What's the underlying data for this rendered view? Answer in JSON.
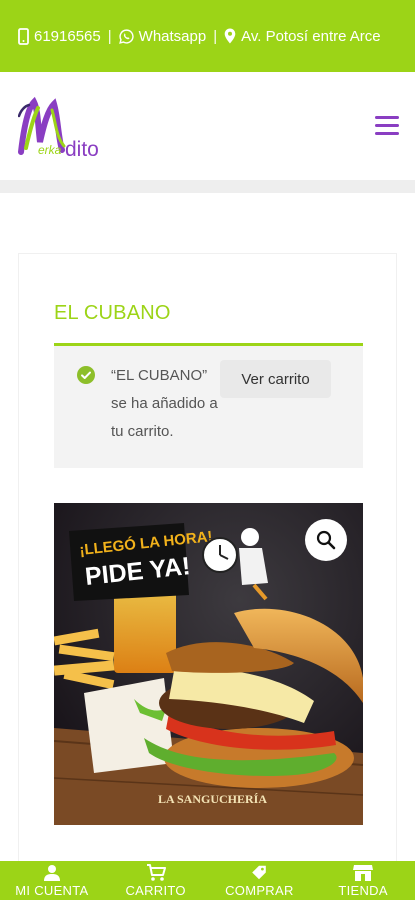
{
  "topbar": {
    "phone": "61916565",
    "whatsapp_label": "Whatsapp",
    "address": "Av. Potosí entre Arce"
  },
  "header": {
    "logo_text": "Merkadito",
    "menu_icon": "hamburger-icon"
  },
  "product": {
    "title": "EL CUBANO"
  },
  "notice": {
    "message": "“EL CUBANO” se ha añadido a tu carrito.",
    "button_label": "Ver carrito",
    "icon": "check-circle-icon"
  },
  "image": {
    "banner_line1": "¡LLEGÓ LA HORA!",
    "banner_line2": "PIDE YA!",
    "brand": "LA SANGUCHERÍA",
    "zoom_icon": "magnifier-icon"
  },
  "bottom_nav": {
    "items": [
      {
        "label": "MI CUENTA",
        "icon": "user-icon"
      },
      {
        "label": "CARRITO",
        "icon": "cart-icon"
      },
      {
        "label": "COMPRAR",
        "icon": "tag-icon"
      },
      {
        "label": "TIENDA",
        "icon": "store-icon"
      }
    ]
  },
  "colors": {
    "brand_green": "#9cd417",
    "brand_purple": "#8a3ec2",
    "notice_bg": "#f3f3f3"
  }
}
